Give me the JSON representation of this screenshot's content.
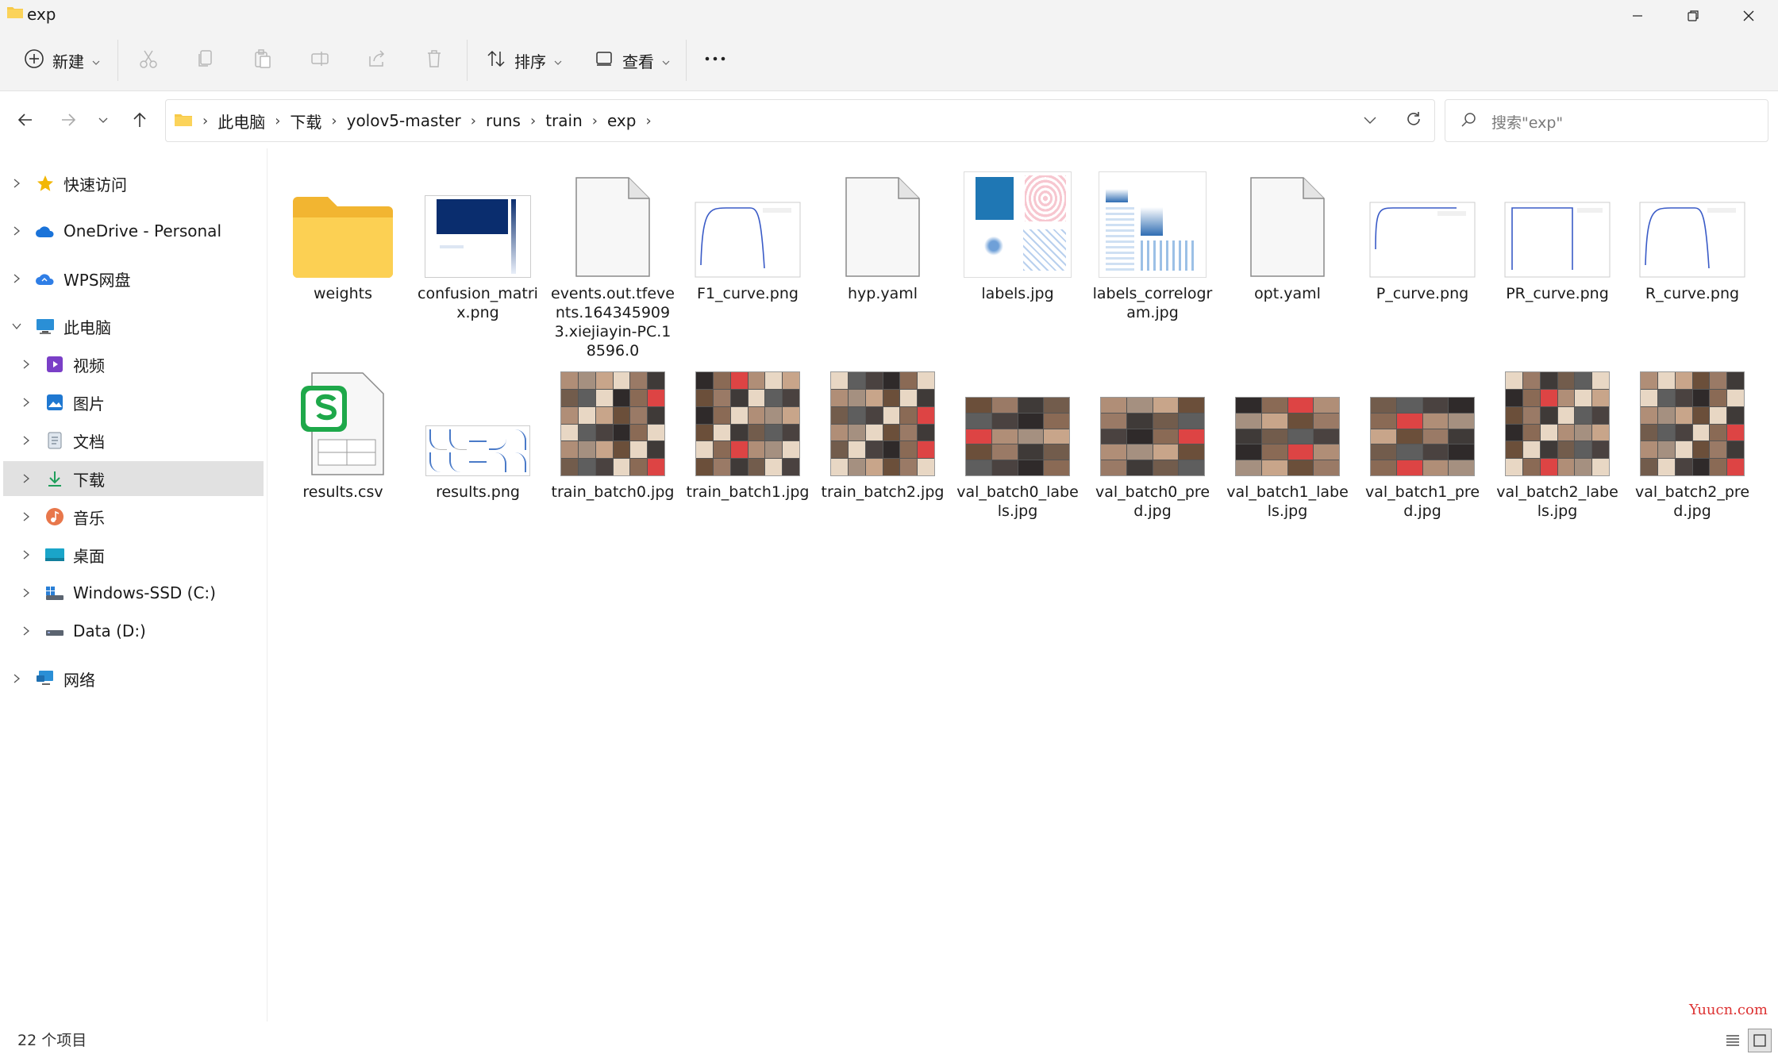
{
  "window": {
    "title": "exp"
  },
  "toolbar": {
    "new_label": "新建",
    "sort_label": "排序",
    "view_label": "查看"
  },
  "breadcrumb": [
    "此电脑",
    "下载",
    "yolov5-master",
    "runs",
    "train",
    "exp"
  ],
  "search": {
    "placeholder": "搜索\"exp\""
  },
  "sidebar": {
    "items": [
      {
        "label": "快速访问",
        "icon": "star-icon"
      },
      {
        "label": "OneDrive - Personal",
        "icon": "cloud-icon"
      },
      {
        "label": "WPS网盘",
        "icon": "cloud-icon"
      },
      {
        "label": "此电脑",
        "icon": "computer-icon"
      },
      {
        "label": "视频",
        "icon": "video-icon"
      },
      {
        "label": "图片",
        "icon": "pictures-icon"
      },
      {
        "label": "文档",
        "icon": "document-icon"
      },
      {
        "label": "下载",
        "icon": "download-icon"
      },
      {
        "label": "音乐",
        "icon": "music-icon"
      },
      {
        "label": "桌面",
        "icon": "desktop-icon"
      },
      {
        "label": "Windows-SSD (C:)",
        "icon": "drive-icon"
      },
      {
        "label": "Data (D:)",
        "icon": "drive-icon"
      },
      {
        "label": "网络",
        "icon": "network-icon"
      }
    ]
  },
  "files": [
    {
      "name": "weights",
      "kind": "folder"
    },
    {
      "name": "confusion_matrix.png",
      "kind": "confusion"
    },
    {
      "name": "events.out.tfevents.1643459093.xiejiayin-PC.18596.0",
      "kind": "blank"
    },
    {
      "name": "F1_curve.png",
      "kind": "curve-fall"
    },
    {
      "name": "hyp.yaml",
      "kind": "blank"
    },
    {
      "name": "labels.jpg",
      "kind": "labels"
    },
    {
      "name": "labels_correlogram.jpg",
      "kind": "correlogram"
    },
    {
      "name": "opt.yaml",
      "kind": "blank"
    },
    {
      "name": "P_curve.png",
      "kind": "curve-rise"
    },
    {
      "name": "PR_curve.png",
      "kind": "curve-box"
    },
    {
      "name": "R_curve.png",
      "kind": "curve-fall"
    },
    {
      "name": "results.csv",
      "kind": "csv"
    },
    {
      "name": "results.png",
      "kind": "results"
    },
    {
      "name": "train_batch0.jpg",
      "kind": "mosaic-train"
    },
    {
      "name": "train_batch1.jpg",
      "kind": "mosaic-train"
    },
    {
      "name": "train_batch2.jpg",
      "kind": "mosaic-train"
    },
    {
      "name": "val_batch0_labels.jpg",
      "kind": "mosaic-val"
    },
    {
      "name": "val_batch0_pred.jpg",
      "kind": "mosaic-val"
    },
    {
      "name": "val_batch1_labels.jpg",
      "kind": "mosaic-val"
    },
    {
      "name": "val_batch1_pred.jpg",
      "kind": "mosaic-val"
    },
    {
      "name": "val_batch2_labels.jpg",
      "kind": "mosaic-train"
    },
    {
      "name": "val_batch2_pred.jpg",
      "kind": "mosaic-train"
    }
  ],
  "status": {
    "count_text": "22 个项目"
  },
  "watermark": "Yuucn.com",
  "colors": {
    "selected_bg": "#e1e1e1",
    "folder": "#f7c948",
    "accent": "#0067c0"
  }
}
